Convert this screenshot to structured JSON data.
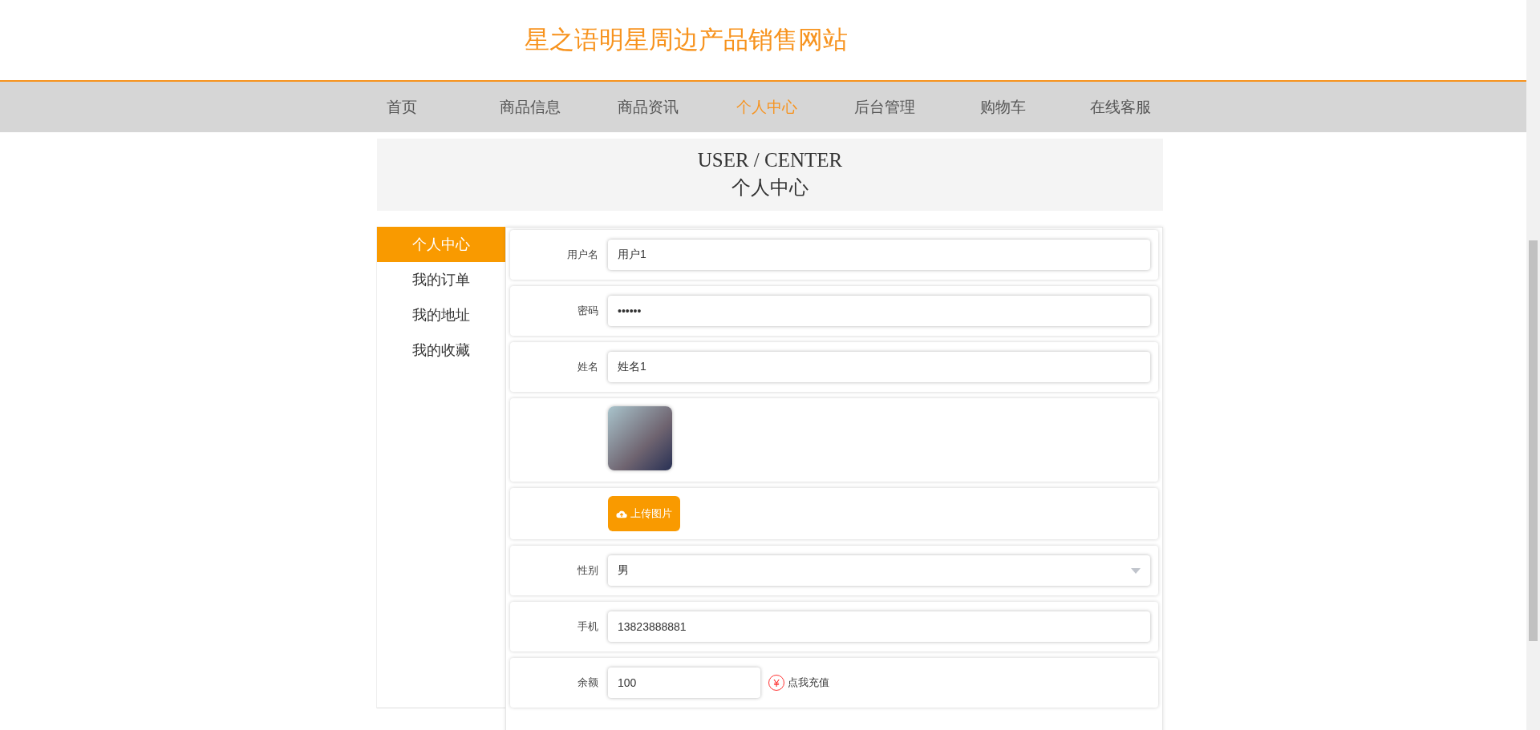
{
  "site_title": "星之语明星周边产品销售网站",
  "nav": [
    {
      "label": "首页",
      "selected": false
    },
    {
      "label": "商品信息",
      "selected": false
    },
    {
      "label": "商品资讯",
      "selected": false
    },
    {
      "label": "个人中心",
      "selected": true
    },
    {
      "label": "后台管理",
      "selected": false
    },
    {
      "label": "购物车",
      "selected": false
    },
    {
      "label": "在线客服",
      "selected": false
    }
  ],
  "banner": {
    "title": "USER / CENTER",
    "subtitle": "个人中心"
  },
  "sidebar": {
    "items": [
      {
        "label": "个人中心",
        "selected": true
      },
      {
        "label": "我的订单",
        "selected": false
      },
      {
        "label": "我的地址",
        "selected": false
      },
      {
        "label": "我的收藏",
        "selected": false
      }
    ]
  },
  "form": {
    "rows": [
      {
        "kind": "text",
        "label": "用户名",
        "value": "用户1"
      },
      {
        "kind": "text",
        "label": "密码",
        "value": "••••••"
      },
      {
        "kind": "text",
        "label": "姓名",
        "value": "姓名1"
      },
      {
        "kind": "image"
      },
      {
        "kind": "upload",
        "button": "上传图片"
      },
      {
        "kind": "select",
        "label": "性别",
        "value": "男"
      },
      {
        "kind": "text",
        "label": "手机",
        "value": "13823888881"
      },
      {
        "kind": "balance",
        "label": "余额",
        "value": "100",
        "icon_text": "¥",
        "link": "点我充值"
      }
    ]
  }
}
